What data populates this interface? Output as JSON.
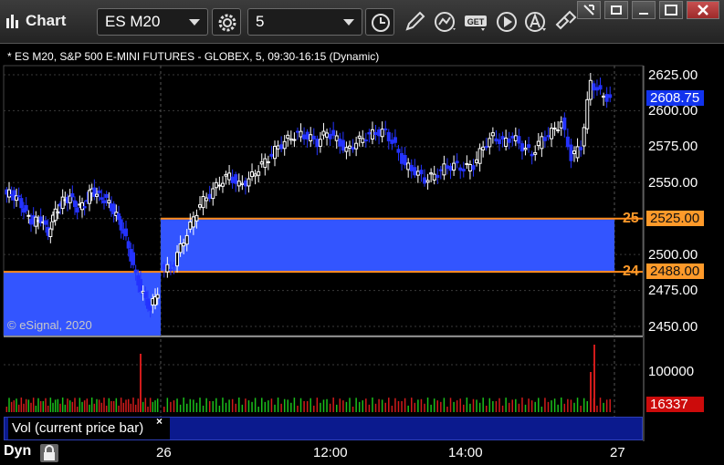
{
  "app": {
    "title": "Chart"
  },
  "toolbar": {
    "symbol": "ES M20",
    "interval": "5",
    "icons": [
      "gear-icon",
      "clock-icon",
      "pencil-icon",
      "study-icon",
      "get-icon",
      "play-icon",
      "alert-icon",
      "link-icon"
    ]
  },
  "window_buttons": [
    "restore-icon",
    "minimize-icon",
    "maximize-icon",
    "close-icon"
  ],
  "chart": {
    "description": "* ES M20, S&P 500 E-MINI FUTURES - GLOBEX, 5, 09:30-16:15 (Dynamic)",
    "copyright": "© eSignal, 2020",
    "current_price": "2608.75",
    "zones": [
      {
        "label": "25",
        "price": "2525.00",
        "value": 2525.0
      },
      {
        "label": "24",
        "price": "2488.00",
        "value": 2488.0
      }
    ],
    "price_axis": [
      "2625.00",
      "2600.00",
      "2575.00",
      "2550.00",
      "2525.00",
      "2500.00",
      "2475.00",
      "2450.00"
    ],
    "volume_axis": "100000",
    "current_volume": "16337",
    "time_axis": [
      "26",
      "12:00",
      "14:00",
      "27"
    ]
  },
  "volume_panel": {
    "label": "Vol (current price bar)",
    "close": "×"
  },
  "footer": {
    "mode": "Dyn"
  },
  "colors": {
    "up": "#ffffff",
    "down": "#2433ff",
    "zone": "#3355ff",
    "zone_border": "#ff8c1a",
    "current_tag": "#0022ee",
    "volume_up": "#1bbf1b",
    "volume_down": "#d11b1b"
  },
  "chart_data": {
    "type": "candlestick",
    "ylim": [
      2450,
      2625
    ],
    "close_series_first_session": [
      2542,
      2538,
      2528,
      2522,
      2525,
      2515,
      2530,
      2537,
      2540,
      2532,
      2535,
      2545,
      2540,
      2538,
      2530,
      2520,
      2505,
      2485,
      2472,
      2462,
      2475
    ],
    "close_series_second_session": [
      2490,
      2505,
      2520,
      2535,
      2542,
      2550,
      2555,
      2548,
      2552,
      2560,
      2567,
      2575,
      2580,
      2584,
      2582,
      2578,
      2585,
      2580,
      2572,
      2578,
      2582,
      2585,
      2585,
      2575,
      2562,
      2558,
      2552,
      2555,
      2560,
      2562,
      2560,
      2562,
      2575,
      2582,
      2578,
      2582,
      2575,
      2570,
      2580,
      2585,
      2592,
      2568,
      2575,
      2620,
      2612,
      2608
    ]
  }
}
